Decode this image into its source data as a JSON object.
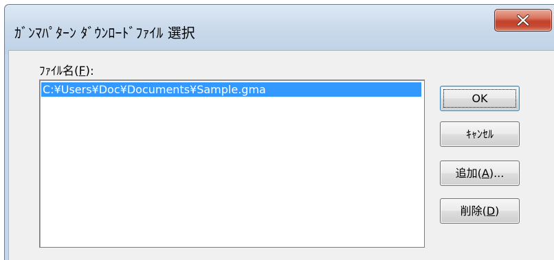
{
  "window": {
    "title": "ｶﾞﾝﾏﾊﾟﾀｰﾝ ﾀﾞｳﾝﾛｰﾄﾞﾌｧｲﾙ 選択",
    "close_label": "×"
  },
  "file_list": {
    "label_prefix": "ﾌｧｲﾙ名(",
    "label_mnemonic": "F",
    "label_suffix": "):",
    "items": [
      "C:¥Users¥Doc¥Documents¥Sample.gma"
    ],
    "selected_index": 0
  },
  "buttons": {
    "ok": {
      "label": "OK"
    },
    "cancel": {
      "label": "ｷｬﾝｾﾙ"
    },
    "add": {
      "prefix": "追加(",
      "mnemonic": "A",
      "suffix": ")..."
    },
    "delete": {
      "prefix": "削除(",
      "mnemonic": "D",
      "suffix": ")"
    }
  },
  "colors": {
    "selection": "#3399ff",
    "close_button": "#c64a33",
    "frame": "#c6d7ea"
  }
}
